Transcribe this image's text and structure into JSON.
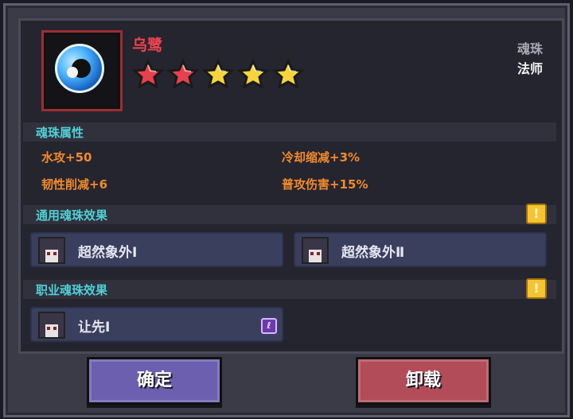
{
  "item": {
    "name": "乌鹭",
    "type_label": "魂珠",
    "class_label": "法师",
    "icon": "blue-soul-orb-icon",
    "rating": 5,
    "stars": [
      {
        "color": "#e8404c"
      },
      {
        "color": "#e8404c"
      },
      {
        "color": "#f6d43a"
      },
      {
        "color": "#f6d43a"
      },
      {
        "color": "#f6d43a"
      }
    ]
  },
  "attributes": {
    "title": "魂珠属性",
    "items": [
      {
        "text": "水攻+50"
      },
      {
        "text": "冷却缩减+3%"
      },
      {
        "text": "韧性削减+6"
      },
      {
        "text": "普攻伤害+15%"
      }
    ]
  },
  "general_effects": {
    "title": "通用魂珠效果",
    "info_icon": "!",
    "items": [
      {
        "label": "超然象外Ⅰ"
      },
      {
        "label": "超然象外Ⅱ"
      }
    ]
  },
  "class_effects": {
    "title": "职业魂珠效果",
    "info_icon": "!",
    "items": [
      {
        "label": "让先Ⅰ",
        "badge": "ℓ"
      }
    ]
  },
  "buttons": {
    "confirm": "确定",
    "unload": "卸载"
  },
  "colors": {
    "name": "#f0434f",
    "section_title": "#4fd0d4",
    "attribute": "#f28a2c",
    "confirm": "#6c5fb0",
    "unload": "#b14c58"
  }
}
